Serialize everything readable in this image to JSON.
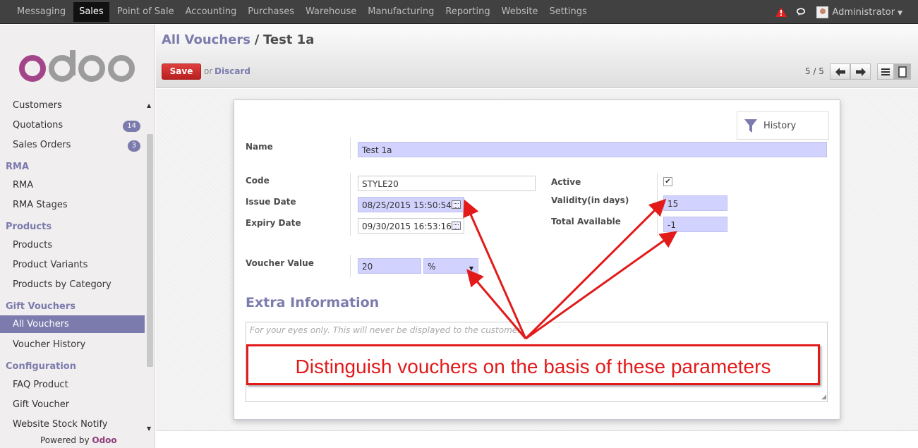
{
  "topbar": {
    "menu": [
      "Messaging",
      "Sales",
      "Point of Sale",
      "Accounting",
      "Purchases",
      "Warehouse",
      "Manufacturing",
      "Reporting",
      "Website",
      "Settings"
    ],
    "active": "Sales",
    "user": "Administrator",
    "icons": [
      "warning-icon",
      "chat-icon",
      "avatar",
      "caret-down-icon"
    ],
    "accent": "#414141"
  },
  "sidebar": {
    "logo": "odoo",
    "items": {
      "customers": "Customers",
      "quotations": "Quotations",
      "quotations_badge": "14",
      "sales_orders": "Sales Orders",
      "sales_orders_badge": "3",
      "rma_head": "RMA",
      "rma": "RMA",
      "rma_stages": "RMA Stages",
      "products_head": "Products",
      "products": "Products",
      "product_variants": "Product Variants",
      "products_by_category": "Products by Category",
      "gift_head": "Gift Vouchers",
      "all_vouchers": "All Vouchers",
      "voucher_history": "Voucher History",
      "config_head": "Configuration",
      "faq_product": "FAQ Product",
      "gift_voucher": "Gift Voucher",
      "website_stock_notify": "Website Stock Notify"
    },
    "powered_prefix": "Powered by",
    "powered_brand": "Odoo",
    "accent": "#7c7bad"
  },
  "header": {
    "breadcrumb_parent": "All Vouchers",
    "breadcrumb_sep": "/",
    "breadcrumb_current": "Test 1a",
    "save_label": "Save",
    "or_label": "or",
    "discard_label": "Discard",
    "pager": "5 / 5"
  },
  "form": {
    "history_label": "History",
    "name_label": "Name",
    "name_value": "Test 1a",
    "code_label": "Code",
    "code_value": "STYLE20",
    "issue_label": "Issue Date",
    "issue_value": "08/25/2015 15:50:54",
    "expiry_label": "Expiry Date",
    "expiry_value": "09/30/2015 16:53:16",
    "active_label": "Active",
    "active_checked": "✔",
    "validity_label": "Validity(in days)",
    "validity_value": "15",
    "total_label": "Total Available",
    "total_value": "-1",
    "voucher_value_label": "Voucher Value",
    "voucher_value": "20",
    "voucher_type": "%",
    "extra_title": "Extra Information",
    "notes_placeholder": "For your eyes only. This will never be displayed to the customer."
  },
  "annotation": {
    "callout_text": "Distinguish vouchers on the basis of these parameters",
    "color": "#e21a1a"
  }
}
